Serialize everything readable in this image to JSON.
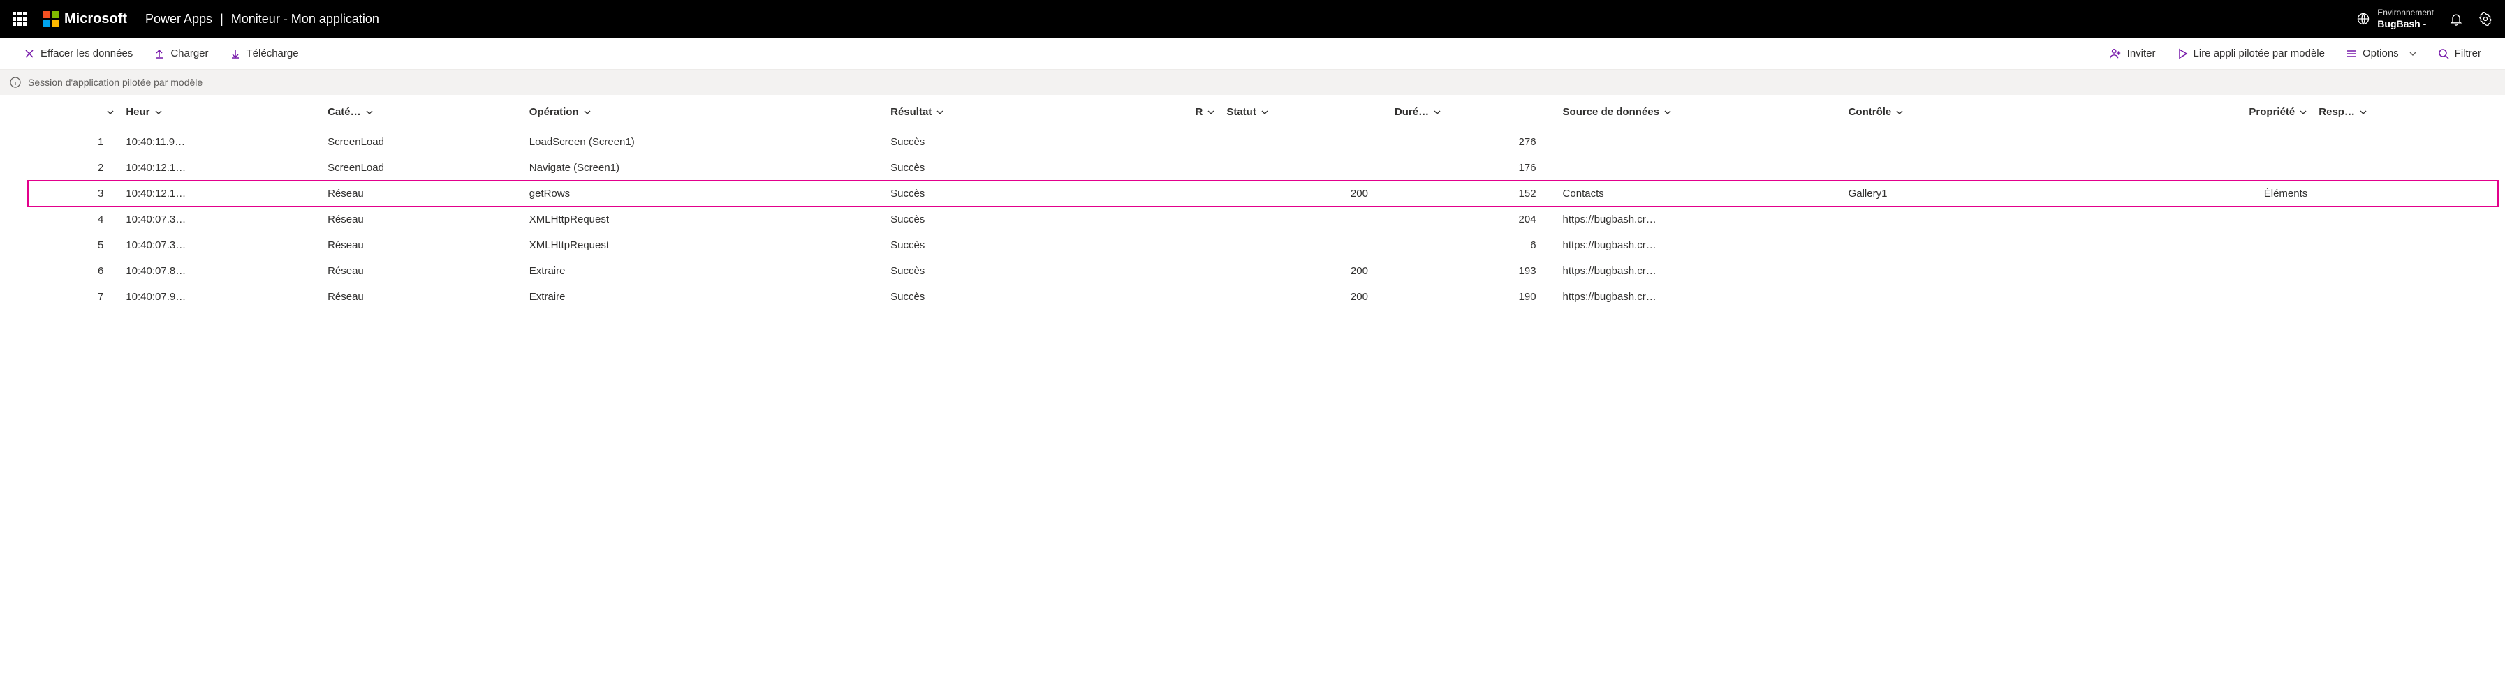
{
  "header": {
    "brand": "Microsoft",
    "product": "Power Apps",
    "separator": "|",
    "page_title": "Moniteur - Mon application",
    "environment": {
      "label": "Environnement",
      "name": "BugBash -"
    }
  },
  "toolbar": {
    "clear": "Effacer les données",
    "upload": "Charger",
    "download": "Télécharge",
    "invite": "Inviter",
    "play": "Lire appli pilotée par modèle",
    "options": "Options",
    "filter": "Filtrer"
  },
  "info_bar": {
    "text": "Session d'application pilotée par modèle"
  },
  "columns": {
    "idx": "",
    "heur": "Heur",
    "cate": "Caté…",
    "op": "Opération",
    "result": "Résultat",
    "r": "R",
    "status": "Statut",
    "dur": "Duré…",
    "source": "Source de données",
    "control": "Contrôle",
    "prop": "Propriété",
    "resp": "Resp…"
  },
  "rows": [
    {
      "idx": "1",
      "heur": "10:40:11.9…",
      "cate": "ScreenLoad",
      "op": "LoadScreen (Screen1)",
      "result": "Succès",
      "r": "",
      "status": "",
      "dur": "276",
      "source": "",
      "control": "",
      "prop": "",
      "resp": "",
      "highlight": false
    },
    {
      "idx": "2",
      "heur": "10:40:12.1…",
      "cate": "ScreenLoad",
      "op": "Navigate (Screen1)",
      "result": "Succès",
      "r": "",
      "status": "",
      "dur": "176",
      "source": "",
      "control": "",
      "prop": "",
      "resp": "",
      "highlight": false
    },
    {
      "idx": "3",
      "heur": "10:40:12.1…",
      "cate": "Réseau",
      "op": "getRows",
      "result": "Succès",
      "r": "",
      "status": "200",
      "dur": "152",
      "source": "Contacts",
      "control": "Gallery1",
      "prop": "Éléments",
      "resp": "",
      "highlight": true
    },
    {
      "idx": "4",
      "heur": "10:40:07.3…",
      "cate": "Réseau",
      "op": "XMLHttpRequest",
      "result": "Succès",
      "r": "",
      "status": "",
      "dur": "204",
      "source": "https://bugbash.cr…",
      "control": "",
      "prop": "",
      "resp": "",
      "highlight": false
    },
    {
      "idx": "5",
      "heur": "10:40:07.3…",
      "cate": "Réseau",
      "op": "XMLHttpRequest",
      "result": "Succès",
      "r": "",
      "status": "",
      "dur": "6",
      "source": "https://bugbash.cr…",
      "control": "",
      "prop": "",
      "resp": "",
      "highlight": false
    },
    {
      "idx": "6",
      "heur": "10:40:07.8…",
      "cate": "Réseau",
      "op": "Extraire",
      "result": "Succès",
      "r": "",
      "status": "200",
      "dur": "193",
      "source": "https://bugbash.cr…",
      "control": "",
      "prop": "",
      "resp": "",
      "highlight": false
    },
    {
      "idx": "7",
      "heur": "10:40:07.9…",
      "cate": "Réseau",
      "op": "Extraire",
      "result": "Succès",
      "r": "",
      "status": "200",
      "dur": "190",
      "source": "https://bugbash.cr…",
      "control": "",
      "prop": "",
      "resp": "",
      "highlight": false
    }
  ]
}
